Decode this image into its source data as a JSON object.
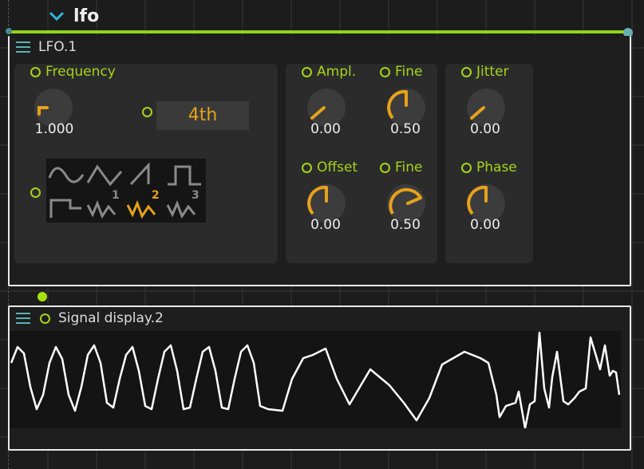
{
  "patch": {
    "title": "lfo"
  },
  "colors": {
    "accent": "#a6d41a",
    "knob": "#e6a21a",
    "cable": "#8fd41a",
    "menu": "#5ab3b3"
  },
  "lfo_module": {
    "title": "LFO.1",
    "frequency": {
      "label": "Frequency",
      "value": "1.000",
      "level": 0.0
    },
    "note": {
      "value": "4th"
    },
    "waveforms": [
      "sine",
      "triangle",
      "saw",
      "square",
      "step",
      "random-1",
      "random-2",
      "random-3"
    ],
    "waveform_numbers": [
      "1",
      "2",
      "3"
    ],
    "selected_waveform": "random-2",
    "ampl": {
      "label": "Ampl.",
      "value": "0.00",
      "level": 0.0
    },
    "ampl_fine": {
      "label": "Fine",
      "value": "0.50",
      "level": 0.5
    },
    "jitter": {
      "label": "Jitter",
      "value": "0.00",
      "level": 0.0
    },
    "offset": {
      "label": "Offset",
      "value": "0.00",
      "level": 0.5
    },
    "offset_fine": {
      "label": "Fine",
      "value": "0.50",
      "level": 0.75
    },
    "phase": {
      "label": "Phase",
      "value": "0.00",
      "level": 0.5
    }
  },
  "signal_module": {
    "title": "Signal display.2"
  }
}
